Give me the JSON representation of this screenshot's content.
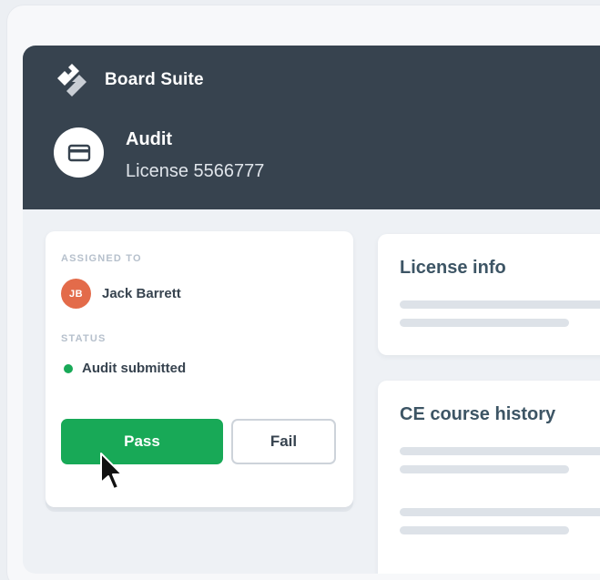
{
  "app": {
    "brand_name": "Board Suite"
  },
  "header": {
    "title": "Audit",
    "subtitle": "License 5566777"
  },
  "assignment": {
    "assigned_label": "ASSIGNED TO",
    "assignee_initials": "JB",
    "assignee_name": "Jack Barrett",
    "avatar_color": "#e36b4a",
    "status_label": "STATUS",
    "status_text": "Audit submitted",
    "status_color": "#18a957"
  },
  "actions": {
    "pass_label": "Pass",
    "fail_label": "Fail"
  },
  "panels": {
    "license_info_title": "License info",
    "ce_history_title": "CE course history"
  },
  "colors": {
    "header_bg": "#37434f",
    "accent_green": "#18a957",
    "page_bg": "#eef1f5"
  },
  "icons": {
    "brand": "diamond-logo-icon",
    "entity": "credit-card-icon",
    "pointer": "mouse-cursor-icon"
  }
}
